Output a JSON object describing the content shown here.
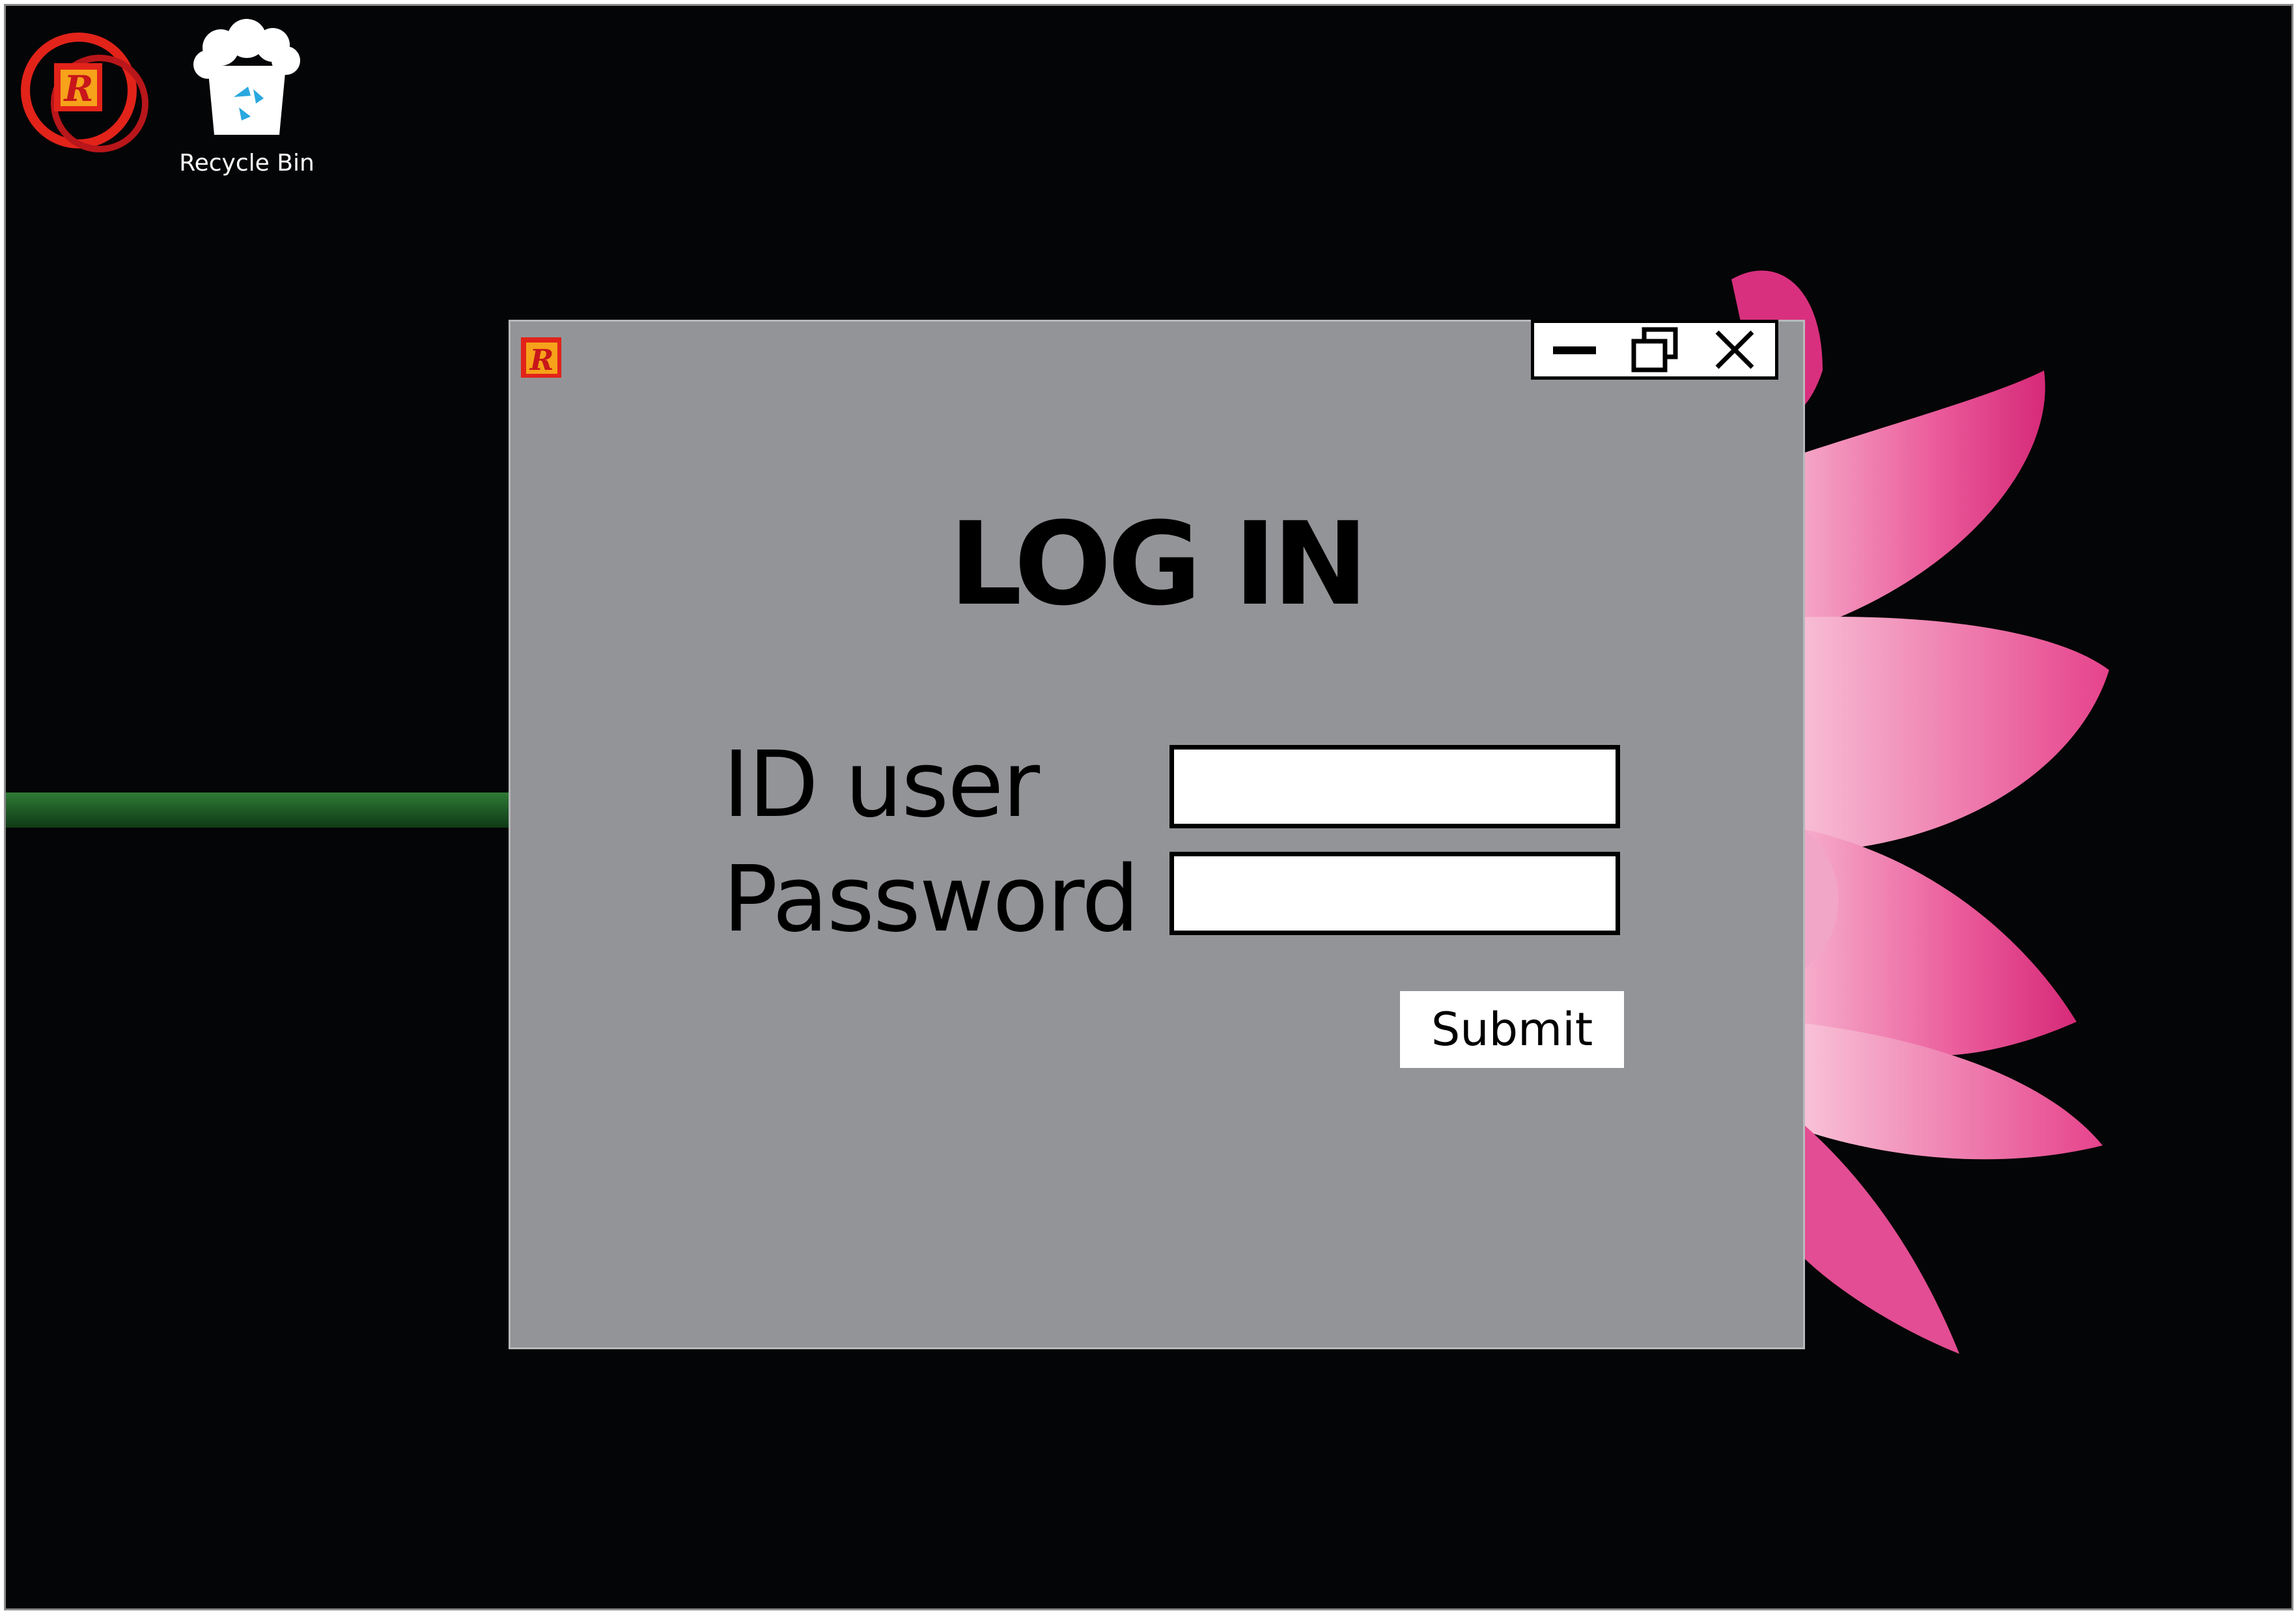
{
  "desktop": {
    "icons": [
      {
        "name": "app-shortcut-icon",
        "label": ""
      },
      {
        "name": "recycle-bin-icon",
        "label": "Recycle Bin"
      }
    ]
  },
  "window": {
    "title": "LOG IN",
    "controls": [
      "minimize-icon",
      "restore-icon",
      "close-icon"
    ],
    "form": {
      "id_label": "ID user",
      "id_value": "",
      "password_label": "Password",
      "password_value": "",
      "submit_label": "Submit"
    }
  },
  "colors": {
    "desktop_bg": "#040506",
    "window_bg": "#939497",
    "app_icon_red": "#e2231a",
    "app_icon_orange": "#f6a21a",
    "recycle_blue": "#29a8e0",
    "flower_pink": "#e94b92",
    "stem_green": "#1f5a28"
  }
}
